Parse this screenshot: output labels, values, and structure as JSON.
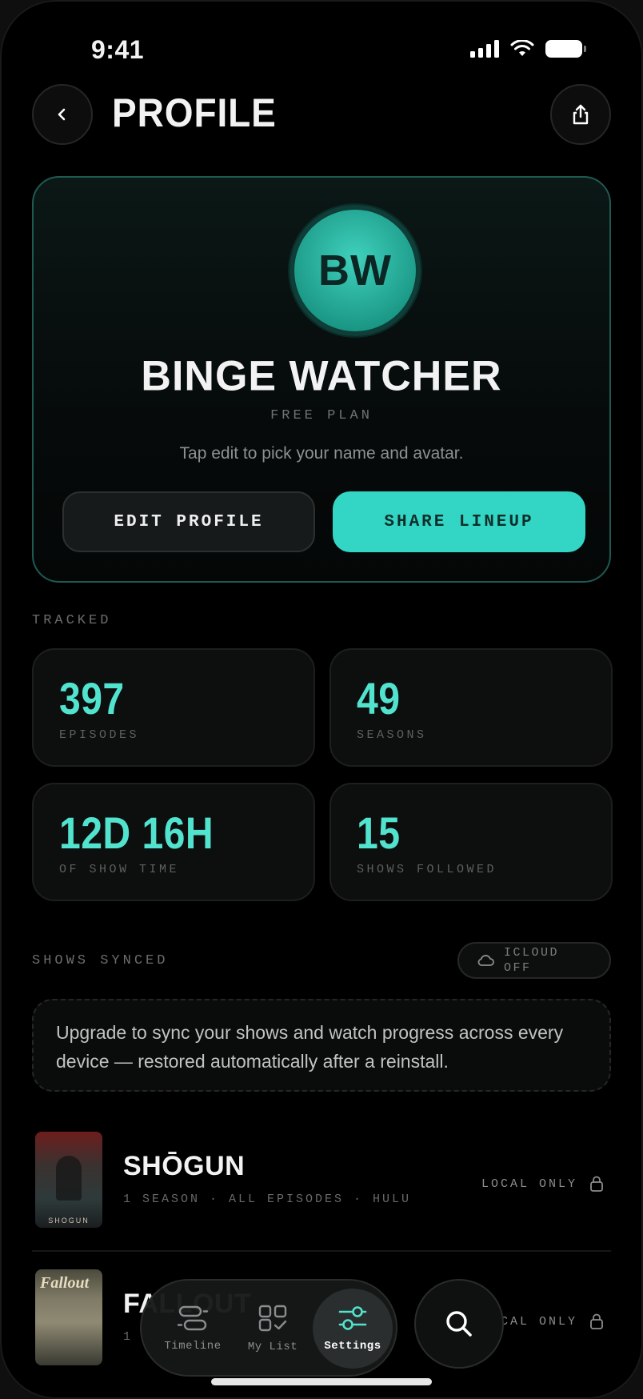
{
  "status_bar": {
    "time": "9:41"
  },
  "header": {
    "title": "PROFILE"
  },
  "profile": {
    "initials": "BW",
    "name": "BINGE WATCHER",
    "plan": "FREE PLAN",
    "hint": "Tap edit to pick your name and avatar.",
    "edit_label": "EDIT PROFILE",
    "share_label": "SHARE LINEUP"
  },
  "tracked": {
    "label": "TRACKED",
    "stats": [
      {
        "value": "397",
        "label": "EPISODES"
      },
      {
        "value": "49",
        "label": "SEASONS"
      },
      {
        "value": "12D 16H",
        "label": "OF SHOW TIME"
      },
      {
        "value": "15",
        "label": "SHOWS FOLLOWED"
      }
    ]
  },
  "synced": {
    "label": "SHOWS SYNCED",
    "icloud_label": "ICLOUD OFF",
    "upgrade_text": "Upgrade to sync your shows and watch progress across every device — restored automatically after a reinstall."
  },
  "shows": [
    {
      "title": "SHŌGUN",
      "meta": "1 SEASON · ALL EPISODES · HULU",
      "sync": "LOCAL ONLY",
      "poster_caption": "SHOGUN"
    },
    {
      "title": "FALLOUT",
      "meta": "1",
      "sync": "LOCAL ONLY",
      "poster_logo": "Fallout"
    }
  ],
  "tabbar": {
    "tabs": [
      {
        "label": "Timeline",
        "icon": "timeline-icon"
      },
      {
        "label": "My List",
        "icon": "my-list-icon"
      },
      {
        "label": "Settings",
        "icon": "settings-sliders-icon",
        "active": true
      }
    ],
    "search_icon": "search-icon"
  },
  "colors": {
    "accent": "#33d6c5",
    "background": "#000000",
    "card_border": "#1f5a52"
  }
}
